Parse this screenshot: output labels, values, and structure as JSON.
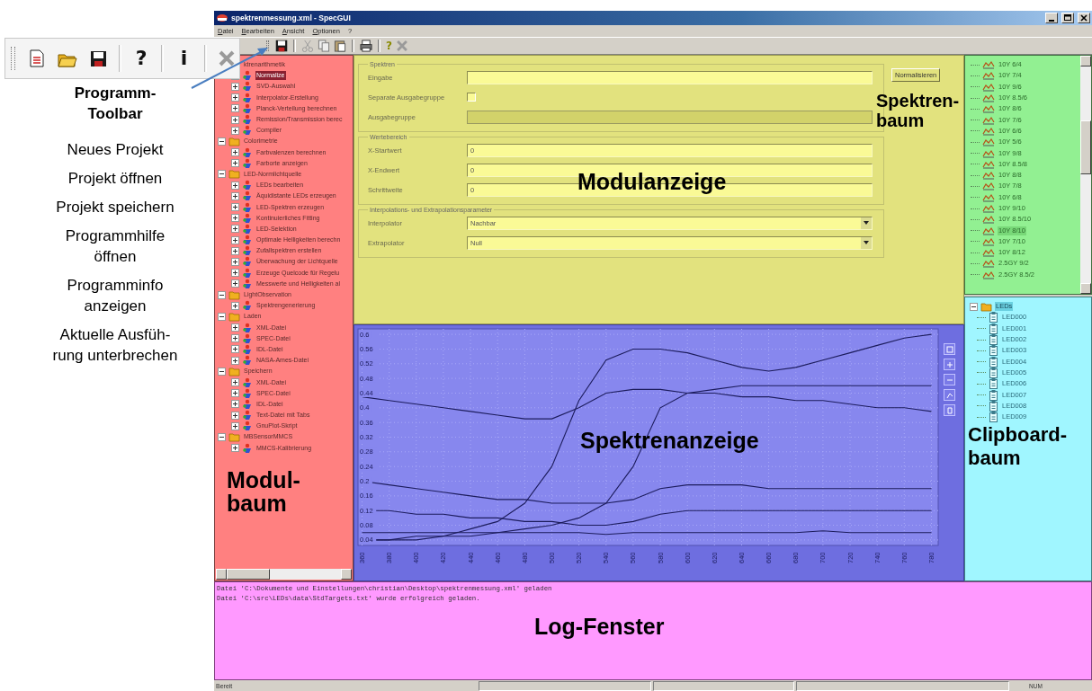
{
  "callout": {
    "title": "Programm-\nToolbar",
    "legend": [
      "Neues Projekt",
      "Projekt öffnen",
      "Projekt speichern",
      "Programmhilfe\nöffnen",
      "Programminfo\nanzeigen",
      "Aktuelle Ausfüh-\nrung unterbrechen"
    ],
    "toolbar": [
      {
        "kind": "new"
      },
      {
        "kind": "open"
      },
      {
        "kind": "save"
      },
      {
        "kind": "help",
        "label": "?"
      },
      {
        "kind": "info",
        "label": "i"
      },
      {
        "kind": "stop"
      }
    ]
  },
  "window": {
    "title": "spektrenmessung.xml - SpecGUI"
  },
  "menu": [
    "Datei",
    "Bearbeiten",
    "Ansicht",
    "Optionen",
    "?"
  ],
  "toolbar": [
    {
      "kind": "save"
    },
    {
      "kind": "cut"
    },
    {
      "kind": "copy"
    },
    {
      "kind": "paste"
    },
    {
      "kind": "print"
    },
    {
      "kind": "help",
      "label": "?"
    },
    {
      "kind": "stop"
    }
  ],
  "module_tree": {
    "items": [
      {
        "kind": "folder",
        "label": "ktrenarithmetik",
        "expanded": true,
        "selected": false,
        "children": [
          {
            "kind": "module",
            "label": "Normalize",
            "expanded": false,
            "selected": true
          },
          {
            "kind": "module",
            "label": "SVD-Auswahl",
            "expanded": false,
            "selected": false
          },
          {
            "kind": "module",
            "label": "Interpolator-Erstellung",
            "expanded": false,
            "selected": false
          },
          {
            "kind": "module",
            "label": "Planck-Verteilung berechnen",
            "expanded": false,
            "selected": false
          },
          {
            "kind": "module",
            "label": "Remission/Transmission berec",
            "expanded": false,
            "selected": false
          },
          {
            "kind": "module",
            "label": "Compiler",
            "expanded": false,
            "selected": false
          }
        ]
      },
      {
        "kind": "folder",
        "label": "Colorimetrie",
        "expanded": true,
        "selected": false,
        "children": [
          {
            "kind": "module",
            "label": "Farbvalenzen berechnen",
            "expanded": false,
            "selected": false
          },
          {
            "kind": "module",
            "label": "Farborte anzeigen",
            "expanded": false,
            "selected": false
          }
        ]
      },
      {
        "kind": "folder",
        "label": "LED-Normlichtquelle",
        "expanded": true,
        "selected": false,
        "children": [
          {
            "kind": "module",
            "label": "LEDs bearbeiten",
            "expanded": false,
            "selected": false
          },
          {
            "kind": "module",
            "label": "Äquidistante LEDs erzeugen",
            "expanded": false,
            "selected": false
          },
          {
            "kind": "module",
            "label": "LED-Spektren erzeugen",
            "expanded": false,
            "selected": false
          },
          {
            "kind": "module",
            "label": "Kontinuierliches Fitting",
            "expanded": false,
            "selected": false
          },
          {
            "kind": "module",
            "label": "LED-Selektion",
            "expanded": false,
            "selected": false
          },
          {
            "kind": "module",
            "label": "Optimale Helligkeiten berechn",
            "expanded": false,
            "selected": false
          },
          {
            "kind": "module",
            "label": "Zufallspektren erstellen",
            "expanded": false,
            "selected": false
          },
          {
            "kind": "module",
            "label": "Überwachung der Lichtquelle",
            "expanded": false,
            "selected": false
          },
          {
            "kind": "module",
            "label": "Erzeuge Quelcode für Regelu",
            "expanded": false,
            "selected": false
          },
          {
            "kind": "module",
            "label": "Messwerte und Helligkeiten al",
            "expanded": false,
            "selected": false
          }
        ]
      },
      {
        "kind": "folder",
        "label": "LightObservation",
        "expanded": true,
        "selected": false,
        "children": [
          {
            "kind": "module",
            "label": "Spektrengenerierung",
            "expanded": false,
            "selected": false
          }
        ]
      },
      {
        "kind": "folder",
        "label": "Laden",
        "expanded": true,
        "selected": false,
        "children": [
          {
            "kind": "module",
            "label": "XML-Datei",
            "expanded": false,
            "selected": false
          },
          {
            "kind": "module",
            "label": "SPEC-Datei",
            "expanded": false,
            "selected": false
          },
          {
            "kind": "module",
            "label": "IDL-Datei",
            "expanded": false,
            "selected": false
          },
          {
            "kind": "module",
            "label": "NASA-Ames-Datei",
            "expanded": false,
            "selected": false
          }
        ]
      },
      {
        "kind": "folder",
        "label": "Speichern",
        "expanded": true,
        "selected": false,
        "children": [
          {
            "kind": "module",
            "label": "XML-Datei",
            "expanded": false,
            "selected": false
          },
          {
            "kind": "module",
            "label": "SPEC-Datei",
            "expanded": false,
            "selected": false
          },
          {
            "kind": "module",
            "label": "IDL-Datei",
            "expanded": false,
            "selected": false
          },
          {
            "kind": "module",
            "label": "Text-Datei mit Tabs",
            "expanded": false,
            "selected": false
          },
          {
            "kind": "module",
            "label": "GnuPlot-Skript",
            "expanded": false,
            "selected": false
          }
        ]
      },
      {
        "kind": "folder",
        "label": "MBSensorMMCS",
        "expanded": true,
        "selected": false,
        "children": [
          {
            "kind": "module",
            "label": "MMCS-Kalibrierung",
            "expanded": false,
            "selected": false
          }
        ]
      }
    ]
  },
  "module_form": {
    "groups": [
      {
        "title": "Spektren",
        "rows": [
          {
            "kind": "text",
            "label": "Eingabe",
            "disabled": false
          },
          {
            "kind": "checkbox",
            "label": "Separate Ausgabegruppe",
            "checked": false
          },
          {
            "kind": "text",
            "label": "Ausgabegruppe",
            "disabled": true
          }
        ]
      },
      {
        "title": "Wertebereich",
        "rows": [
          {
            "kind": "text",
            "label": "X-Startwert",
            "value": "0",
            "disabled": false
          },
          {
            "kind": "text",
            "label": "X-Endwert",
            "value": "0",
            "disabled": false
          },
          {
            "kind": "text",
            "label": "Schrittweite",
            "value": "0",
            "disabled": false
          }
        ]
      },
      {
        "title": "Interpolations- und Extrapolationsparameter",
        "rows": [
          {
            "kind": "select",
            "label": "Interpolator",
            "value": "Nachbar"
          },
          {
            "kind": "select",
            "label": "Extrapolator",
            "value": "Null"
          }
        ]
      }
    ],
    "button": "Normalisieren"
  },
  "spectrum_view": {
    "chart_data": {
      "type": "line",
      "x": [
        360,
        380,
        400,
        420,
        440,
        460,
        480,
        500,
        520,
        540,
        560,
        580,
        600,
        620,
        640,
        660,
        680,
        700,
        720,
        740,
        760,
        780
      ],
      "series": [
        {
          "color": "#1c1c5c",
          "values": [
            0.04,
            0.04,
            0.05,
            0.05,
            0.07,
            0.09,
            0.14,
            0.24,
            0.42,
            0.53,
            0.56,
            0.56,
            0.55,
            0.53,
            0.51,
            0.5,
            0.51,
            0.53,
            0.55,
            0.57,
            0.59,
            0.6
          ]
        },
        {
          "color": "#1c1c5c",
          "values": [
            0.43,
            0.42,
            0.41,
            0.4,
            0.39,
            0.38,
            0.37,
            0.37,
            0.4,
            0.44,
            0.45,
            0.45,
            0.44,
            0.44,
            0.43,
            0.43,
            0.42,
            0.42,
            0.41,
            0.4,
            0.4,
            0.39
          ]
        },
        {
          "color": "#1c1c5c",
          "values": [
            0.04,
            0.04,
            0.04,
            0.05,
            0.05,
            0.06,
            0.07,
            0.08,
            0.1,
            0.14,
            0.24,
            0.4,
            0.44,
            0.45,
            0.46,
            0.46,
            0.46,
            0.46,
            0.46,
            0.46,
            0.46,
            0.46
          ]
        },
        {
          "color": "#1c1c5c",
          "values": [
            0.2,
            0.19,
            0.18,
            0.17,
            0.16,
            0.15,
            0.15,
            0.14,
            0.14,
            0.14,
            0.15,
            0.18,
            0.19,
            0.19,
            0.19,
            0.18,
            0.18,
            0.18,
            0.18,
            0.18,
            0.18,
            0.18
          ]
        },
        {
          "color": "#1c1c5c",
          "values": [
            0.12,
            0.12,
            0.11,
            0.11,
            0.1,
            0.1,
            0.09,
            0.09,
            0.08,
            0.08,
            0.09,
            0.11,
            0.12,
            0.12,
            0.12,
            0.12,
            0.12,
            0.12,
            0.12,
            0.12,
            0.12,
            0.12
          ]
        },
        {
          "color": "#1c1c5c",
          "values": [
            0.06,
            0.06,
            0.06,
            0.06,
            0.06,
            0.06,
            0.06,
            0.06,
            0.06,
            0.055,
            0.06,
            0.06,
            0.06,
            0.06,
            0.06,
            0.06,
            0.06,
            0.065,
            0.06,
            0.06,
            0.06,
            0.06
          ]
        }
      ],
      "grid": true,
      "xlim": [
        357,
        785
      ],
      "ylim": [
        0.025,
        0.615
      ],
      "xticks": [
        360,
        380,
        400,
        420,
        440,
        460,
        480,
        500,
        520,
        540,
        560,
        580,
        600,
        620,
        640,
        660,
        680,
        700,
        720,
        740,
        760,
        780
      ],
      "yticks": [
        0.04,
        0.08,
        0.12,
        0.16,
        0.2,
        0.24,
        0.28,
        0.32,
        0.36,
        0.4,
        0.44,
        0.48,
        0.52,
        0.56,
        0.6
      ]
    }
  },
  "spectrum_tree": {
    "items": [
      {
        "kind": "spectrum",
        "label": "10Y 6/4",
        "selected": false
      },
      {
        "kind": "spectrum",
        "label": "10Y 7/4",
        "selected": false
      },
      {
        "kind": "spectrum",
        "label": "10Y 9/6",
        "selected": false
      },
      {
        "kind": "spectrum",
        "label": "10Y 8.5/6",
        "selected": false
      },
      {
        "kind": "spectrum",
        "label": "10Y 8/6",
        "selected": false
      },
      {
        "kind": "spectrum",
        "label": "10Y 7/6",
        "selected": false
      },
      {
        "kind": "spectrum",
        "label": "10Y 6/6",
        "selected": false
      },
      {
        "kind": "spectrum",
        "label": "10Y 5/6",
        "selected": false
      },
      {
        "kind": "spectrum",
        "label": "10Y 9/8",
        "selected": false
      },
      {
        "kind": "spectrum",
        "label": "10Y 8.5/8",
        "selected": false
      },
      {
        "kind": "spectrum",
        "label": "10Y 8/8",
        "selected": false
      },
      {
        "kind": "spectrum",
        "label": "10Y 7/8",
        "selected": false
      },
      {
        "kind": "spectrum",
        "label": "10Y 6/8",
        "selected": false
      },
      {
        "kind": "spectrum",
        "label": "10Y 9/10",
        "selected": false
      },
      {
        "kind": "spectrum",
        "label": "10Y 8.5/10",
        "selected": false
      },
      {
        "kind": "spectrum",
        "label": "10Y 8/10",
        "selected": true
      },
      {
        "kind": "spectrum",
        "label": "10Y 7/10",
        "selected": false
      },
      {
        "kind": "spectrum",
        "label": "10Y 8/12",
        "selected": false
      },
      {
        "kind": "spectrum",
        "label": "2.5GY 9/2",
        "selected": false
      },
      {
        "kind": "spectrum",
        "label": "2.5GY 8.5/2",
        "selected": false
      }
    ]
  },
  "clipboard_tree": {
    "items": [
      {
        "kind": "folder",
        "label": "LEDs",
        "expanded": true,
        "selected": true,
        "children": [
          {
            "kind": "clipboard",
            "label": "LED000",
            "selected": false
          },
          {
            "kind": "clipboard",
            "label": "LED001",
            "selected": false
          },
          {
            "kind": "clipboard",
            "label": "LED002",
            "selected": false
          },
          {
            "kind": "clipboard",
            "label": "LED003",
            "selected": false
          },
          {
            "kind": "clipboard",
            "label": "LED004",
            "selected": false
          },
          {
            "kind": "clipboard",
            "label": "LED005",
            "selected": false
          },
          {
            "kind": "clipboard",
            "label": "LED006",
            "selected": false
          },
          {
            "kind": "clipboard",
            "label": "LED007",
            "selected": false
          },
          {
            "kind": "clipboard",
            "label": "LED008",
            "selected": false
          },
          {
            "kind": "clipboard",
            "label": "LED009",
            "selected": false
          }
        ]
      }
    ]
  },
  "log": {
    "lines": [
      "Datei 'C:\\Dokumente und Einstellungen\\christian\\Desktop\\spektrenmessung.xml' geladen",
      "Datei 'C:\\src\\LEDs\\data\\StdTargets.txt' wurde erfolgreich geladen."
    ]
  },
  "status_bar": {
    "text": "Bereit",
    "indicator": "NUM"
  },
  "region_labels": [
    {
      "kind": "module_tree",
      "text": "Modul-\nbaum"
    },
    {
      "kind": "module_view",
      "text": "Modulanzeige"
    },
    {
      "kind": "spectrum_tree",
      "text": "Spektren-\nbaum"
    },
    {
      "kind": "spectrum_view",
      "text": "Spektrenanzeige"
    },
    {
      "kind": "clipboard_tree",
      "text": "Clipboard-\nbaum"
    },
    {
      "kind": "log",
      "text": "Log-Fenster"
    }
  ]
}
